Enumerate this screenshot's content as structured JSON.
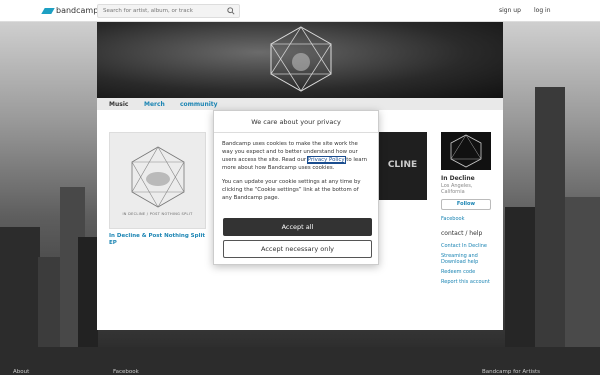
{
  "topbar": {
    "logo_text": "bandcamp",
    "search_placeholder": "Search for artist, album, or track",
    "signup": "sign up",
    "login": "log in"
  },
  "tabs": [
    "Music",
    "Merch",
    "community"
  ],
  "album": {
    "cover_caption": "IN DECLINE / POST NOTHING SPLIT",
    "title": "In Decline & Post Nothing Split EP"
  },
  "album2": {
    "cover_text": "CLINE"
  },
  "sidebar": {
    "band_name": "In Decline",
    "location": "Los Angeles, California",
    "follow_label": "Follow",
    "facebook": "Facebook",
    "contact_header": "contact / help",
    "links": [
      "Contact In Decline",
      "Streaming and Download help",
      "Redeem code",
      "Report this account"
    ]
  },
  "modal": {
    "title": "We care about your privacy",
    "para1_before": "Bandcamp uses cookies to make the site work the way you expect and to better understand how our users access the site. Read our ",
    "privacy_link": "Privacy Policy",
    "para1_after": " to learn more about how Bandcamp uses cookies.",
    "para2": "You can update your cookie settings at any time by clicking the “Cookie settings” link at the bottom of any Bandcamp page.",
    "accept_all": "Accept all",
    "accept_necessary": "Accept necessary only"
  },
  "footer": {
    "about": "About",
    "facebook": "Facebook",
    "for_artists": "Bandcamp for Artists"
  },
  "colors": {
    "accent": "#1a84b3",
    "logo_blue": "#1da0c3"
  }
}
